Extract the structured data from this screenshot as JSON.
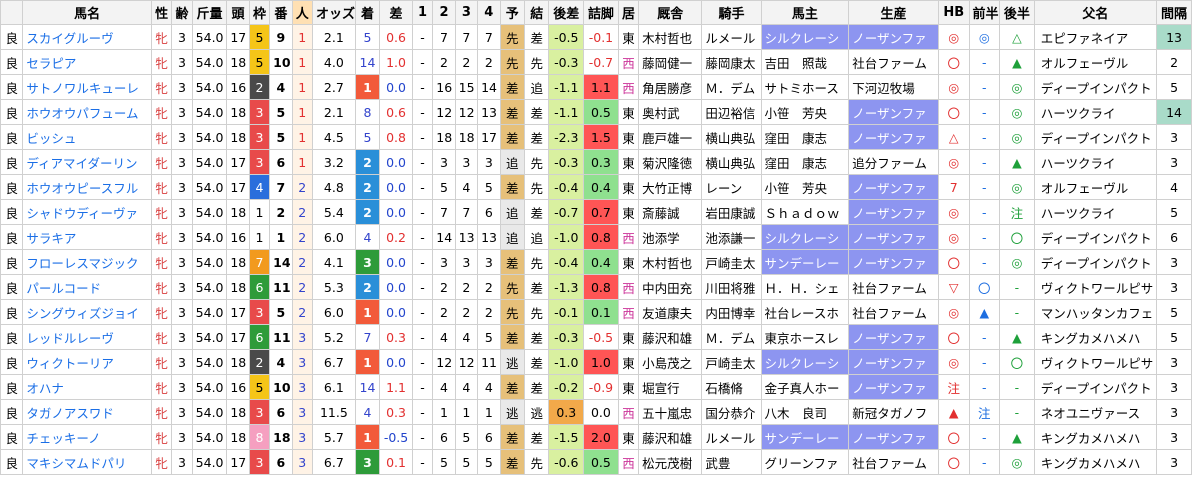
{
  "headers": [
    "",
    "馬名",
    "性",
    "齢",
    "斤量",
    "頭",
    "枠",
    "番",
    "人",
    "オッズ",
    "着",
    "差",
    "1",
    "2",
    "3",
    "4",
    "予",
    "結",
    "後差",
    "詰脚",
    "居",
    "厩舎",
    "騎手",
    "馬主",
    "生産",
    "HB",
    "前半",
    "後半",
    "父名",
    "間隔"
  ],
  "colors": {
    "waku1": "#ffffff",
    "waku2": "#4a4a4a",
    "waku3": "#e84a4a",
    "waku4": "#2a6edc",
    "waku5": "#f5c518",
    "waku6": "#2e9b3a",
    "waku7": "#f29a1e",
    "waku8": "#f59fc0",
    "chaku1": "#f25a3a",
    "chaku2": "#2a8fd8",
    "chaku3": "#2e9b3a",
    "chakuOther": "#ffffff",
    "yosoBg": "#e6c07a",
    "yosoPlain": "#e9e9e9",
    "atoSa": "#d9f0a0",
    "tsumeHigh": "#ff5555",
    "tsumeMid": "#8fe08f"
  },
  "rows": [
    {
      "baba": "良",
      "name": "スカイグルーヴ",
      "sex": "牝",
      "age": "3",
      "kin": "54.0",
      "to": "17",
      "waku": "5",
      "ban": "9",
      "nin": "1",
      "odds": "2.1",
      "chaku": "5",
      "sa": "0.6",
      "p1": "-",
      "p2": "7",
      "p3": "7",
      "p4": "7",
      "yoso": "先",
      "ketsu": "差",
      "atosa": "-0.5",
      "tsume": "-0.1",
      "kyo": "東",
      "kyusha": "木村哲也",
      "kishu": "ルメール",
      "banushi": "シルクレーシ",
      "seisan": "ノーザンファ",
      "banushiHl": true,
      "seisanHl": true,
      "hb": "◎",
      "zen": "◎",
      "kou": "△",
      "father": "エピファネイア",
      "kankaku": "13",
      "kkHl": true
    },
    {
      "baba": "良",
      "name": "セラピア",
      "sex": "牝",
      "age": "3",
      "kin": "54.0",
      "to": "18",
      "waku": "5",
      "ban": "10",
      "nin": "1",
      "odds": "4.0",
      "chaku": "14",
      "sa": "1.0",
      "p1": "-",
      "p2": "2",
      "p3": "2",
      "p4": "2",
      "yoso": "先",
      "ketsu": "先",
      "atosa": "-0.3",
      "tsume": "-0.7",
      "kyo": "西",
      "kyusha": "藤岡健一",
      "kishu": "藤岡康太",
      "banushi": "吉田　照哉",
      "seisan": "社台ファーム",
      "banushiHl": false,
      "seisanHl": false,
      "hb": "〇",
      "zen": "-",
      "kou": "▲",
      "father": "オルフェーヴル",
      "kankaku": "2",
      "kkHl": false
    },
    {
      "baba": "良",
      "name": "サトノワルキューレ",
      "sex": "牝",
      "age": "3",
      "kin": "54.0",
      "to": "16",
      "waku": "2",
      "ban": "4",
      "nin": "1",
      "odds": "2.7",
      "chaku": "1",
      "sa": "0.0",
      "p1": "-",
      "p2": "16",
      "p3": "15",
      "p4": "14",
      "yoso": "差",
      "ketsu": "追",
      "atosa": "-1.1",
      "tsume": "1.1",
      "kyo": "西",
      "kyusha": "角居勝彦",
      "kishu": "Ｍ．デム",
      "banushi": "サトミホース",
      "seisan": "下河辺牧場",
      "banushiHl": false,
      "seisanHl": false,
      "hb": "◎",
      "zen": "-",
      "kou": "◎",
      "father": "ディープインパクト",
      "kankaku": "5",
      "kkHl": false
    },
    {
      "baba": "良",
      "name": "ホウオウパフューム",
      "sex": "牝",
      "age": "3",
      "kin": "54.0",
      "to": "18",
      "waku": "3",
      "ban": "5",
      "nin": "1",
      "odds": "2.1",
      "chaku": "8",
      "sa": "0.6",
      "p1": "-",
      "p2": "12",
      "p3": "12",
      "p4": "13",
      "yoso": "差",
      "ketsu": "差",
      "atosa": "-1.1",
      "tsume": "0.5",
      "kyo": "東",
      "kyusha": "奥村武",
      "kishu": "田辺裕信",
      "banushi": "小笹　芳央",
      "seisan": "ノーザンファ",
      "banushiHl": false,
      "seisanHl": true,
      "hb": "〇",
      "zen": "-",
      "kou": "◎",
      "father": "ハーツクライ",
      "kankaku": "14",
      "kkHl": true
    },
    {
      "baba": "良",
      "name": "ビッシュ",
      "sex": "牝",
      "age": "3",
      "kin": "54.0",
      "to": "18",
      "waku": "3",
      "ban": "5",
      "nin": "1",
      "odds": "4.5",
      "chaku": "5",
      "sa": "0.8",
      "p1": "-",
      "p2": "18",
      "p3": "18",
      "p4": "17",
      "yoso": "差",
      "ketsu": "差",
      "atosa": "-2.3",
      "tsume": "1.5",
      "kyo": "東",
      "kyusha": "鹿戸雄一",
      "kishu": "横山典弘",
      "banushi": "窪田　康志",
      "seisan": "ノーザンファ",
      "banushiHl": false,
      "seisanHl": true,
      "hb": "△",
      "zen": "-",
      "kou": "◎",
      "father": "ディープインパクト",
      "kankaku": "3",
      "kkHl": false
    },
    {
      "baba": "良",
      "name": "ディアマイダーリン",
      "sex": "牝",
      "age": "3",
      "kin": "54.0",
      "to": "17",
      "waku": "3",
      "ban": "6",
      "nin": "1",
      "odds": "3.2",
      "chaku": "2",
      "sa": "0.0",
      "p1": "-",
      "p2": "3",
      "p3": "3",
      "p4": "3",
      "yoso": "追",
      "ketsu": "先",
      "atosa": "-0.3",
      "tsume": "0.3",
      "kyo": "東",
      "kyusha": "菊沢隆徳",
      "kishu": "横山典弘",
      "banushi": "窪田　康志",
      "seisan": "追分ファーム",
      "banushiHl": false,
      "seisanHl": false,
      "hb": "◎",
      "zen": "-",
      "kou": "▲",
      "father": "ハーツクライ",
      "kankaku": "3",
      "kkHl": false
    },
    {
      "baba": "良",
      "name": "ホウオウピースフル",
      "sex": "牝",
      "age": "3",
      "kin": "54.0",
      "to": "17",
      "waku": "4",
      "ban": "7",
      "nin": "2",
      "odds": "4.8",
      "chaku": "2",
      "sa": "0.0",
      "p1": "-",
      "p2": "5",
      "p3": "4",
      "p4": "5",
      "yoso": "差",
      "ketsu": "先",
      "atosa": "-0.4",
      "tsume": "0.4",
      "kyo": "東",
      "kyusha": "大竹正博",
      "kishu": "レーン",
      "banushi": "小笹　芳央",
      "seisan": "ノーザンファ",
      "banushiHl": false,
      "seisanHl": true,
      "hb": "7",
      "zen": "-",
      "kou": "◎",
      "father": "オルフェーヴル",
      "kankaku": "4",
      "kkHl": false
    },
    {
      "baba": "良",
      "name": "シャドウディーヴァ",
      "sex": "牝",
      "age": "3",
      "kin": "54.0",
      "to": "18",
      "waku": "1",
      "ban": "2",
      "nin": "2",
      "odds": "5.4",
      "chaku": "2",
      "sa": "0.0",
      "p1": "-",
      "p2": "7",
      "p3": "7",
      "p4": "6",
      "yoso": "追",
      "ketsu": "差",
      "atosa": "-0.7",
      "tsume": "0.7",
      "kyo": "東",
      "kyusha": "斎藤誠",
      "kishu": "岩田康誠",
      "banushi": "Ｓｈａｄｏｗ",
      "seisan": "ノーザンファ",
      "banushiHl": false,
      "seisanHl": true,
      "hb": "◎",
      "zen": "-",
      "kou": "注",
      "father": "ハーツクライ",
      "kankaku": "5",
      "kkHl": false
    },
    {
      "baba": "良",
      "name": "サラキア",
      "sex": "牝",
      "age": "3",
      "kin": "54.0",
      "to": "16",
      "waku": "1",
      "ban": "1",
      "nin": "2",
      "odds": "6.0",
      "chaku": "4",
      "sa": "0.2",
      "p1": "-",
      "p2": "14",
      "p3": "13",
      "p4": "13",
      "yoso": "追",
      "ketsu": "追",
      "atosa": "-1.0",
      "tsume": "0.8",
      "kyo": "西",
      "kyusha": "池添学",
      "kishu": "池添謙一",
      "banushi": "シルクレーシ",
      "seisan": "ノーザンファ",
      "banushiHl": true,
      "seisanHl": true,
      "hb": "◎",
      "zen": "-",
      "kou": "〇",
      "father": "ディープインパクト",
      "kankaku": "6",
      "kkHl": false
    },
    {
      "baba": "良",
      "name": "フローレスマジック",
      "sex": "牝",
      "age": "3",
      "kin": "54.0",
      "to": "18",
      "waku": "7",
      "ban": "14",
      "nin": "2",
      "odds": "4.1",
      "chaku": "3",
      "sa": "0.0",
      "p1": "-",
      "p2": "3",
      "p3": "3",
      "p4": "3",
      "yoso": "差",
      "ketsu": "先",
      "atosa": "-0.4",
      "tsume": "0.4",
      "kyo": "東",
      "kyusha": "木村哲也",
      "kishu": "戸崎圭太",
      "banushi": "サンデーレー",
      "seisan": "ノーザンファ",
      "banushiHl": true,
      "seisanHl": true,
      "hb": "〇",
      "zen": "-",
      "kou": "◎",
      "father": "ディープインパクト",
      "kankaku": "3",
      "kkHl": false
    },
    {
      "baba": "良",
      "name": "パールコード",
      "sex": "牝",
      "age": "3",
      "kin": "54.0",
      "to": "18",
      "waku": "6",
      "ban": "11",
      "nin": "2",
      "odds": "5.3",
      "chaku": "2",
      "sa": "0.0",
      "p1": "-",
      "p2": "2",
      "p3": "2",
      "p4": "2",
      "yoso": "先",
      "ketsu": "差",
      "atosa": "-1.3",
      "tsume": "0.8",
      "kyo": "西",
      "kyusha": "中内田充",
      "kishu": "川田将雅",
      "banushi": "Ｈ．Ｈ．シェ",
      "seisan": "社台ファーム",
      "banushiHl": false,
      "seisanHl": false,
      "hb": "▽",
      "zen": "〇",
      "kou": "-",
      "father": "ヴィクトワールピサ",
      "kankaku": "3",
      "kkHl": false
    },
    {
      "baba": "良",
      "name": "シングウィズジョイ",
      "sex": "牝",
      "age": "3",
      "kin": "54.0",
      "to": "17",
      "waku": "3",
      "ban": "5",
      "nin": "2",
      "odds": "6.0",
      "chaku": "1",
      "sa": "0.0",
      "p1": "-",
      "p2": "2",
      "p3": "2",
      "p4": "2",
      "yoso": "先",
      "ketsu": "先",
      "atosa": "-0.1",
      "tsume": "0.1",
      "kyo": "西",
      "kyusha": "友道康夫",
      "kishu": "内田博幸",
      "banushi": "社台レースホ",
      "seisan": "社台ファーム",
      "banushiHl": false,
      "seisanHl": false,
      "hb": "◎",
      "zen": "▲",
      "kou": "-",
      "father": "マンハッタンカフェ",
      "kankaku": "5",
      "kkHl": false
    },
    {
      "baba": "良",
      "name": "レッドルレーヴ",
      "sex": "牝",
      "age": "3",
      "kin": "54.0",
      "to": "17",
      "waku": "6",
      "ban": "11",
      "nin": "3",
      "odds": "5.2",
      "chaku": "7",
      "sa": "0.3",
      "p1": "-",
      "p2": "4",
      "p3": "4",
      "p4": "5",
      "yoso": "差",
      "ketsu": "差",
      "atosa": "-0.3",
      "tsume": "-0.5",
      "kyo": "東",
      "kyusha": "藤沢和雄",
      "kishu": "Ｍ．デム",
      "banushi": "東京ホースレ",
      "seisan": "ノーザンファ",
      "banushiHl": false,
      "seisanHl": true,
      "hb": "〇",
      "zen": "-",
      "kou": "▲",
      "father": "キングカメハメハ",
      "kankaku": "5",
      "kkHl": false
    },
    {
      "baba": "良",
      "name": "ウィクトーリア",
      "sex": "牝",
      "age": "3",
      "kin": "54.0",
      "to": "18",
      "waku": "2",
      "ban": "4",
      "nin": "3",
      "odds": "6.7",
      "chaku": "1",
      "sa": "0.0",
      "p1": "-",
      "p2": "12",
      "p3": "12",
      "p4": "11",
      "yoso": "逃",
      "ketsu": "差",
      "atosa": "-1.0",
      "tsume": "1.0",
      "kyo": "東",
      "kyusha": "小島茂之",
      "kishu": "戸崎圭太",
      "banushi": "シルクレーシ",
      "seisan": "ノーザンファ",
      "banushiHl": true,
      "seisanHl": true,
      "hb": "◎",
      "zen": "-",
      "kou": "〇",
      "father": "ヴィクトワールピサ",
      "kankaku": "3",
      "kkHl": false
    },
    {
      "baba": "良",
      "name": "オハナ",
      "sex": "牝",
      "age": "3",
      "kin": "54.0",
      "to": "16",
      "waku": "5",
      "ban": "10",
      "nin": "3",
      "odds": "6.1",
      "chaku": "14",
      "sa": "1.1",
      "p1": "-",
      "p2": "4",
      "p3": "4",
      "p4": "4",
      "yoso": "差",
      "ketsu": "差",
      "atosa": "-0.2",
      "tsume": "-0.9",
      "kyo": "東",
      "kyusha": "堀宣行",
      "kishu": "石橋脩",
      "banushi": "金子真人ホー",
      "seisan": "ノーザンファ",
      "banushiHl": false,
      "seisanHl": true,
      "hb": "注",
      "zen": "-",
      "kou": "-",
      "father": "ディープインパクト",
      "kankaku": "3",
      "kkHl": false
    },
    {
      "baba": "良",
      "name": "タガノアスワド",
      "sex": "牝",
      "age": "3",
      "kin": "54.0",
      "to": "18",
      "waku": "3",
      "ban": "6",
      "nin": "3",
      "odds": "11.5",
      "chaku": "4",
      "sa": "0.3",
      "p1": "-",
      "p2": "1",
      "p3": "1",
      "p4": "1",
      "yoso": "逃",
      "ketsu": "逃",
      "atosa": "0.3",
      "tsume": "0.0",
      "kyo": "西",
      "kyusha": "五十嵐忠",
      "kishu": "国分恭介",
      "banushi": "八木　良司",
      "seisan": "新冠タガノフ",
      "banushiHl": false,
      "seisanHl": false,
      "hb": "▲",
      "zen": "注",
      "kou": "-",
      "father": "ネオユニヴァース",
      "kankaku": "3",
      "kkHl": false
    },
    {
      "baba": "良",
      "name": "チェッキーノ",
      "sex": "牝",
      "age": "3",
      "kin": "54.0",
      "to": "18",
      "waku": "8",
      "ban": "18",
      "nin": "3",
      "odds": "5.7",
      "chaku": "1",
      "sa": "-0.5",
      "p1": "-",
      "p2": "6",
      "p3": "5",
      "p4": "6",
      "yoso": "差",
      "ketsu": "差",
      "atosa": "-1.5",
      "tsume": "2.0",
      "kyo": "東",
      "kyusha": "藤沢和雄",
      "kishu": "ルメール",
      "banushi": "サンデーレー",
      "seisan": "ノーザンファ",
      "banushiHl": true,
      "seisanHl": true,
      "hb": "〇",
      "zen": "-",
      "kou": "▲",
      "father": "キングカメハメハ",
      "kankaku": "3",
      "kkHl": false
    },
    {
      "baba": "良",
      "name": "マキシマムドパリ",
      "sex": "牝",
      "age": "3",
      "kin": "54.0",
      "to": "17",
      "waku": "3",
      "ban": "6",
      "nin": "3",
      "odds": "6.7",
      "chaku": "3",
      "sa": "0.1",
      "p1": "-",
      "p2": "5",
      "p3": "5",
      "p4": "5",
      "yoso": "差",
      "ketsu": "先",
      "atosa": "-0.6",
      "tsume": "0.5",
      "kyo": "西",
      "kyusha": "松元茂樹",
      "kishu": "武豊",
      "banushi": "グリーンファ",
      "seisan": "社台ファーム",
      "banushiHl": false,
      "seisanHl": false,
      "hb": "〇",
      "zen": "-",
      "kou": "◎",
      "father": "キングカメハメハ",
      "kankaku": "3",
      "kkHl": false
    }
  ]
}
